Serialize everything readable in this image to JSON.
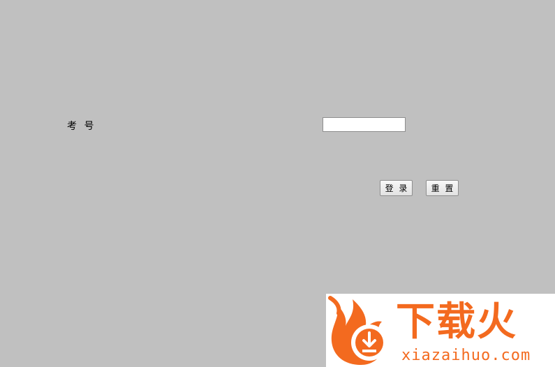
{
  "form": {
    "exam_number_label": "考 号",
    "exam_number_value": "",
    "login_button": "登 录",
    "reset_button": "重 置"
  },
  "watermark": {
    "brand_cn": "下载火",
    "brand_en": "xiazaihuo.com",
    "brand_color": "#f36a1f",
    "icon": "flame-download-icon"
  },
  "colors": {
    "background": "#c0c0c0"
  }
}
